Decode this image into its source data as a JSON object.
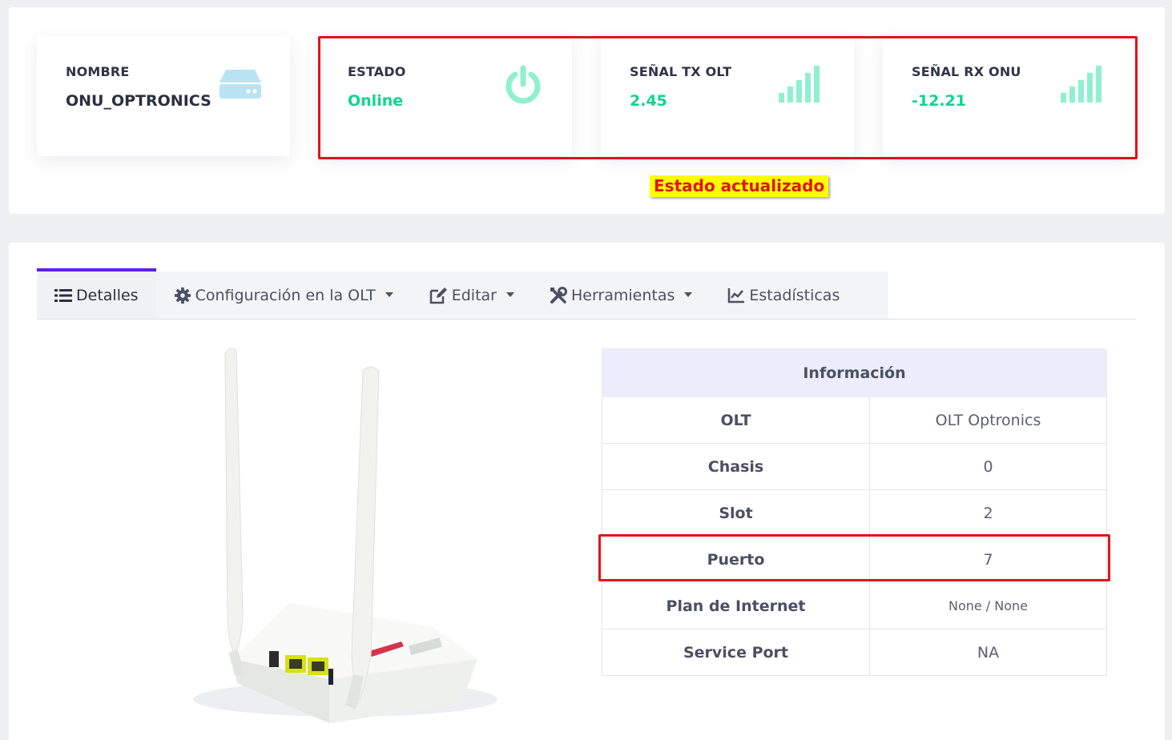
{
  "cards": {
    "nombre": {
      "label": "NOMBRE",
      "value": "ONU_OPTRONICS",
      "icon": "server-icon"
    },
    "estado": {
      "label": "ESTADO",
      "value": "Online",
      "icon": "power-icon"
    },
    "tx": {
      "label": "SEÑAL TX OLT",
      "value": "2.45",
      "icon": "signal-bars-icon"
    },
    "rx": {
      "label": "SEÑAL RX ONU",
      "value": "-12.21",
      "icon": "signal-bars-icon"
    }
  },
  "annotation": {
    "text": "Estado actualizado"
  },
  "tabs": [
    {
      "label": "Detalles",
      "icon": "list-icon",
      "active": true,
      "dropdown": false
    },
    {
      "label": "Configuración en la OLT",
      "icon": "gear-icon",
      "active": false,
      "dropdown": true
    },
    {
      "label": "Editar",
      "icon": "edit-icon",
      "active": false,
      "dropdown": true
    },
    {
      "label": "Herramientas",
      "icon": "tools-icon",
      "active": false,
      "dropdown": true
    },
    {
      "label": "Estadísticas",
      "icon": "chart-icon",
      "active": false,
      "dropdown": false
    }
  ],
  "info": {
    "header": "Información",
    "rows": [
      {
        "key": "OLT",
        "value": "OLT Optronics"
      },
      {
        "key": "Chasis",
        "value": "0"
      },
      {
        "key": "Slot",
        "value": "2"
      },
      {
        "key": "Puerto",
        "value": "7"
      },
      {
        "key": "Plan de Internet",
        "value": "None / None"
      },
      {
        "key": "Service Port",
        "value": "NA"
      }
    ]
  },
  "colors": {
    "accent": "#5b20f2",
    "online_green": "#10d48e",
    "icon_green": "#8ff0cf",
    "server_icon": "#b9e3f3",
    "highlight_red": "#e0141a",
    "note_yellow": "#ffff00"
  }
}
